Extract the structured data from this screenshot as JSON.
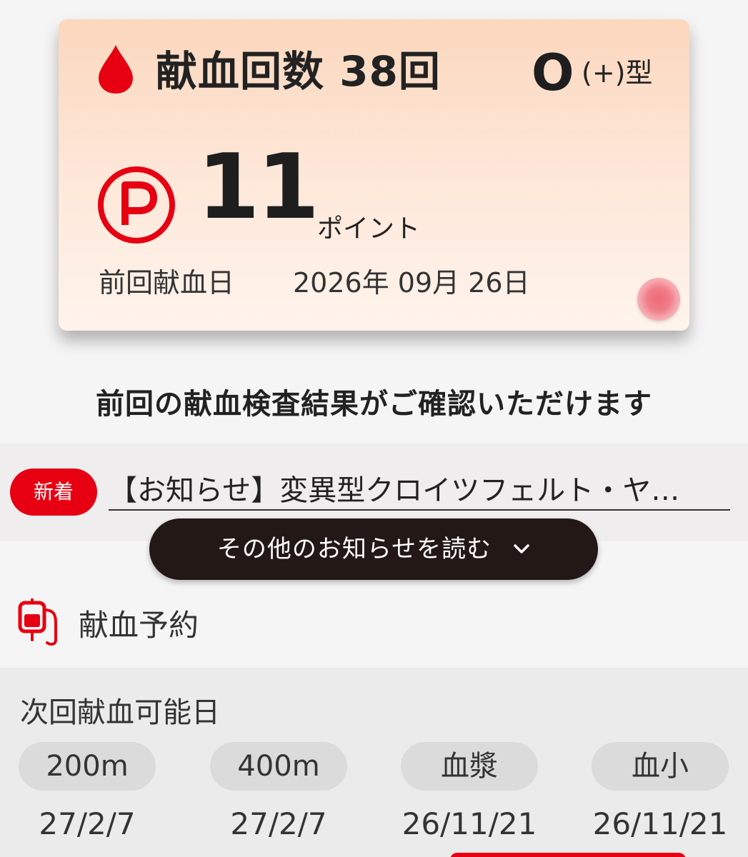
{
  "card": {
    "donation_count_label": "献血回数 38回",
    "blood_type": "O",
    "rh_type": "(+)型",
    "points_value": "11",
    "points_unit": "ポイント",
    "last_donation_label": "前回献血日",
    "last_donation_date": "2026年 09月 26日",
    "icons": [
      "blood-drop-icon",
      "points-p-icon",
      "pulse-dot-icon"
    ]
  },
  "test_results_link": "前回の献血検査結果がご確認いただけます",
  "news": {
    "badge": "新着",
    "headline": "【お知らせ】変異型クロイツフェルト・ヤ…",
    "more_button": "その他のお知らせを読む"
  },
  "reservation": {
    "label": "献血予約",
    "icon": "blood-bag-icon"
  },
  "next_donation": {
    "title": "次回献血可能日",
    "types": [
      {
        "label": "200m",
        "date": "27/2/7"
      },
      {
        "label": "400m",
        "date": "27/2/7"
      },
      {
        "label": "血漿",
        "date": "26/11/21"
      },
      {
        "label": "血小",
        "date": "26/11/21"
      }
    ]
  },
  "colors": {
    "brand_red": "#e60012",
    "dark_button": "#231815",
    "card_gradient_top": "#fbd7bd",
    "card_gradient_bottom": "#fff4ed"
  }
}
